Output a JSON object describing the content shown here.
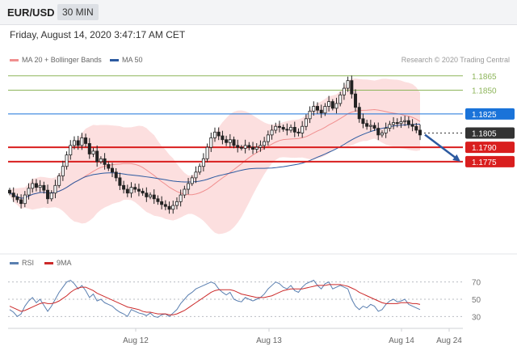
{
  "header": {
    "symbol": "EUR/USD",
    "timeframe": "30 MIN"
  },
  "datetime": "Friday, August 14, 2020 3:47:17 AM CET",
  "legend": {
    "bb_label": "MA 20 + Bollinger Bands",
    "bb_color": "#f08f8f",
    "ma50_label": "MA 50",
    "ma50_color": "#2c5aa0"
  },
  "credit": "Research © 2020 Trading Central",
  "rsi_legend": {
    "rsi_label": "RSI",
    "rsi_color": "#5a7fb0",
    "ma_label": "9MA",
    "ma_color": "#cc2a2a"
  },
  "chart_data": [
    {
      "type": "candlestick",
      "title": "EUR/USD",
      "ylim": [
        1.169,
        1.1875
      ],
      "x_ticks": [
        "Aug 12",
        "Aug 13",
        "Aug 14",
        "Aug 24"
      ],
      "close": [
        1.1742,
        1.1738,
        1.1735,
        1.1731,
        1.174,
        1.1747,
        1.1752,
        1.1748,
        1.175,
        1.1745,
        1.1736,
        1.1742,
        1.175,
        1.176,
        1.177,
        1.1782,
        1.1792,
        1.1797,
        1.1792,
        1.18,
        1.1794,
        1.1783,
        1.1786,
        1.1775,
        1.1778,
        1.1772,
        1.1768,
        1.1764,
        1.1758,
        1.175,
        1.1746,
        1.1742,
        1.1748,
        1.1746,
        1.1744,
        1.1742,
        1.1738,
        1.174,
        1.1736,
        1.1733,
        1.173,
        1.1728,
        1.1725,
        1.1729,
        1.1733,
        1.174,
        1.1746,
        1.1752,
        1.1758,
        1.1764,
        1.177,
        1.1778,
        1.179,
        1.18,
        1.1806,
        1.1802,
        1.1798,
        1.1795,
        1.1798,
        1.1792,
        1.179,
        1.1789,
        1.1792,
        1.179,
        1.1788,
        1.179,
        1.1792,
        1.1796,
        1.1803,
        1.1808,
        1.1812,
        1.1811,
        1.1809,
        1.1808,
        1.1811,
        1.1806,
        1.1805,
        1.1812,
        1.182,
        1.1828,
        1.1833,
        1.1829,
        1.1826,
        1.1833,
        1.1838,
        1.1831,
        1.1836,
        1.1845,
        1.1852,
        1.186,
        1.1846,
        1.1832,
        1.182,
        1.1815,
        1.1812,
        1.1813,
        1.181,
        1.1803,
        1.1805,
        1.181,
        1.1814,
        1.1816,
        1.1815,
        1.1817,
        1.1818,
        1.1814,
        1.1812,
        1.1808,
        1.1803
      ],
      "levels": [
        {
          "value": 1.1865,
          "label": "1.1865",
          "style": "resistance",
          "color": "#8db55a"
        },
        {
          "value": 1.185,
          "label": "1.1850",
          "style": "resistance",
          "color": "#8db55a"
        },
        {
          "value": 1.1825,
          "label": "1.1825",
          "style": "pivot",
          "color": "#1a73d9"
        },
        {
          "value": 1.1805,
          "label": "1.1805",
          "style": "last price",
          "color": "#333333"
        },
        {
          "value": 1.179,
          "label": "1.1790",
          "style": "support",
          "color": "#d91e1e"
        },
        {
          "value": 1.1775,
          "label": "1.1775",
          "style": "support",
          "color": "#d91e1e"
        }
      ],
      "projection": {
        "from": 1.1805,
        "to": 1.1775,
        "color": "#2c5aa0"
      }
    },
    {
      "type": "line",
      "title": "RSI",
      "ylim": [
        20,
        80
      ],
      "y_ticks": [
        "70",
        "50",
        "30"
      ],
      "series": [
        {
          "name": "RSI",
          "values": [
            38,
            35,
            30,
            33,
            42,
            48,
            52,
            46,
            50,
            43,
            36,
            42,
            50,
            58,
            64,
            70,
            72,
            68,
            62,
            66,
            60,
            52,
            56,
            48,
            50,
            46,
            44,
            42,
            38,
            35,
            33,
            30,
            38,
            36,
            34,
            33,
            31,
            34,
            30,
            29,
            32,
            33,
            30,
            34,
            38,
            45,
            50,
            55,
            58,
            62,
            64,
            66,
            68,
            70,
            68,
            62,
            58,
            55,
            58,
            50,
            48,
            47,
            52,
            50,
            48,
            50,
            52,
            56,
            62,
            66,
            70,
            68,
            64,
            62,
            66,
            60,
            58,
            64,
            68,
            70,
            72,
            66,
            62,
            68,
            70,
            62,
            64,
            66,
            64,
            62,
            50,
            42,
            38,
            42,
            40,
            44,
            42,
            36,
            38,
            44,
            48,
            50,
            47,
            48,
            50,
            44,
            42,
            40,
            38
          ]
        },
        {
          "name": "9MA",
          "values": [
            42,
            40,
            38,
            36,
            37,
            39,
            41,
            43,
            45,
            46,
            45,
            45,
            46,
            48,
            51,
            54,
            58,
            61,
            63,
            64,
            64,
            62,
            60,
            57,
            55,
            53,
            51,
            49,
            47,
            45,
            43,
            41,
            40,
            39,
            38,
            36,
            35,
            35,
            34,
            33,
            33,
            33,
            32,
            32,
            33,
            35,
            37,
            40,
            43,
            46,
            49,
            52,
            55,
            58,
            60,
            61,
            61,
            61,
            61,
            60,
            58,
            56,
            55,
            54,
            53,
            52,
            52,
            52,
            53,
            54,
            56,
            58,
            60,
            61,
            62,
            62,
            62,
            62,
            63,
            64,
            65,
            66,
            66,
            66,
            67,
            67,
            67,
            67,
            66,
            65,
            63,
            61,
            58,
            56,
            54,
            52,
            50,
            48,
            46,
            45,
            45,
            45,
            45,
            46,
            46,
            46,
            45,
            45,
            44
          ]
        }
      ]
    }
  ]
}
